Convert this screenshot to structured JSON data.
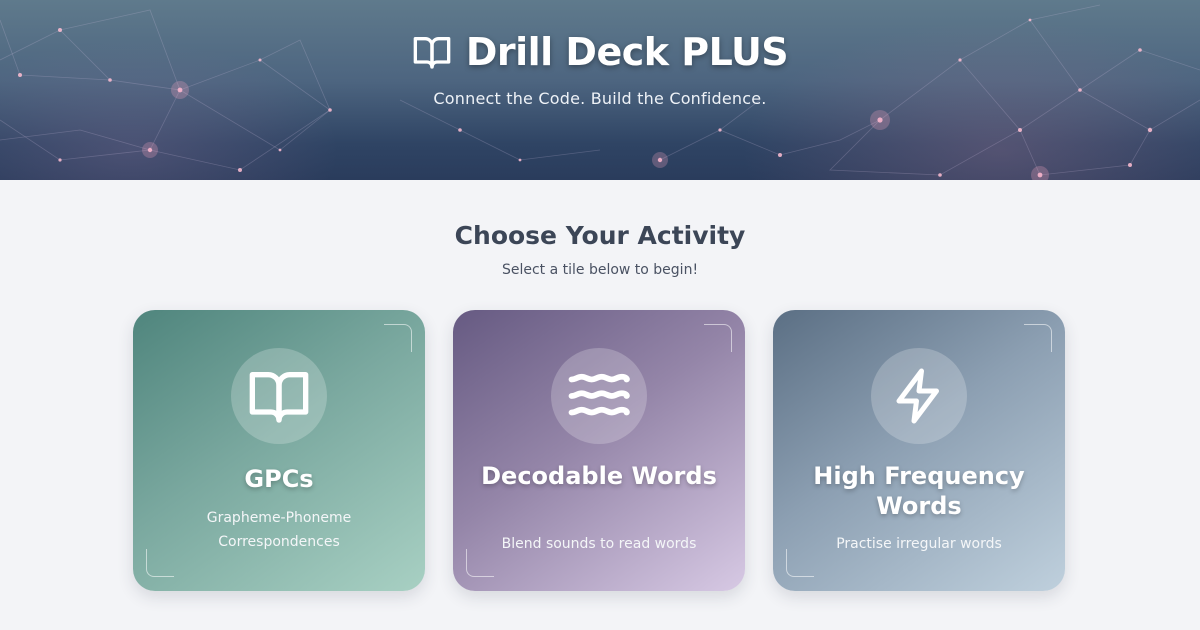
{
  "header": {
    "title": "Drill Deck PLUS",
    "tagline": "Connect the Code. Build the Confidence.",
    "logo_icon": "open-book-icon"
  },
  "main": {
    "heading": "Choose Your Activity",
    "subheading": "Select a tile below to begin!",
    "tiles": [
      {
        "title": "GPCs",
        "description": "Grapheme-Phoneme Correspondences",
        "icon": "open-book-icon",
        "color": "#7aa89f"
      },
      {
        "title": "Decodable Words",
        "description": "Blend sounds to read words",
        "icon": "waves-icon",
        "color": "#9485a8"
      },
      {
        "title": "High Frequency Words",
        "description": "Practise irregular words",
        "icon": "lightning-icon",
        "color": "#8c9fb2"
      }
    ]
  },
  "colors": {
    "header_top": "#5f7a8c",
    "header_bottom": "#2a3c5c",
    "page_background": "#f3f4f7",
    "heading_text": "#3c4657"
  }
}
